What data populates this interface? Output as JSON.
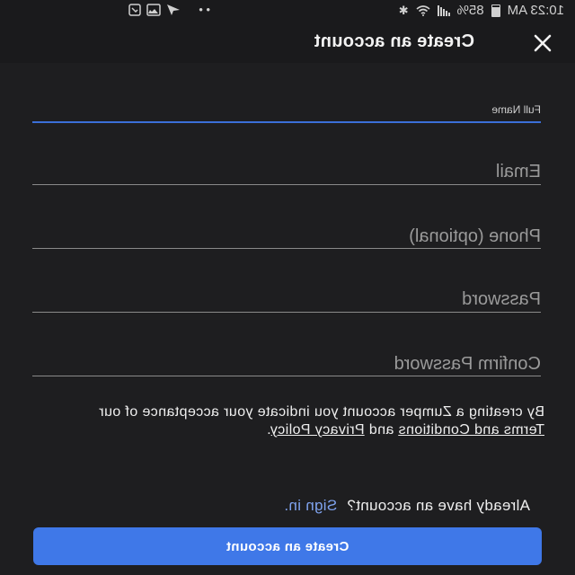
{
  "status_bar": {
    "time": "10:23 AM",
    "battery": "85%",
    "icons": [
      "battery-icon",
      "signal-icon",
      "wifi-icon",
      "bluetooth-icon",
      "gallery-icon",
      "send-icon",
      "dots-icon"
    ]
  },
  "header": {
    "title": "Create an account",
    "close_icon": "close-icon"
  },
  "form": {
    "full_name": {
      "label": "Full Name",
      "value": ""
    },
    "email": {
      "label": "Email",
      "value": ""
    },
    "phone": {
      "label": "Phone (optional)",
      "value": ""
    },
    "password": {
      "label": "Password",
      "value": ""
    },
    "confirm_password": {
      "label": "Confirm Password",
      "value": ""
    }
  },
  "terms": {
    "prefix": "By creating a Zumper account you indicate your acceptance of our ",
    "terms_link": "Terms and Conditions",
    "middle": " and ",
    "privacy_link": "Privacy Policy",
    "suffix": "."
  },
  "signin": {
    "prompt": "Already have an account?",
    "link": "Sign in."
  },
  "actions": {
    "create_label": "Create an account"
  },
  "colors": {
    "background": "#1e1e20",
    "accent": "#3f78e8",
    "active_underline": "#3b6fd8",
    "link": "#7fa3ef"
  }
}
